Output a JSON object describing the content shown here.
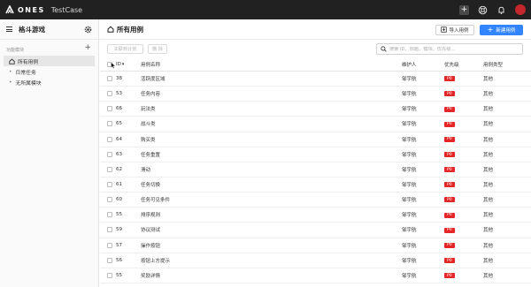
{
  "topbar": {
    "brand": "ONES",
    "app_name": "TestCase",
    "plus_label": "+"
  },
  "sidebar": {
    "project_name": "格斗游戏",
    "section_label": "功能模块",
    "add_label": "+",
    "items": [
      {
        "label": "所有用例",
        "active": true
      },
      {
        "label": "日常任务",
        "active": false
      },
      {
        "label": "无所属模块",
        "active": false
      }
    ]
  },
  "main": {
    "title": "所有用例",
    "import_label": "导入用例",
    "new_label": "新建用例",
    "toolbar": {
      "plan_label": "关联到计划",
      "delete_label": "删 除",
      "search_placeholder": "搜索 ID、标题、模块、优先级..."
    },
    "table": {
      "headers": {
        "id": "ID",
        "name": "用例名称",
        "owner": "维护人",
        "priority": "优先级",
        "type": "用例类型"
      },
      "rows": [
        {
          "id": "38",
          "name": "活跃度区域",
          "owner": "邹宇航",
          "priority": "P0",
          "type": "其他"
        },
        {
          "id": "53",
          "name": "任务内容",
          "owner": "邹宇航",
          "priority": "P0",
          "type": "其他"
        },
        {
          "id": "66",
          "name": "玩法类",
          "owner": "邹宇航",
          "priority": "P0",
          "type": "其他"
        },
        {
          "id": "65",
          "name": "战斗类",
          "owner": "邹宇航",
          "priority": "P0",
          "type": "其他"
        },
        {
          "id": "64",
          "name": "购买类",
          "owner": "邹宇航",
          "priority": "P0",
          "type": "其他"
        },
        {
          "id": "63",
          "name": "任务重置",
          "owner": "邹宇航",
          "priority": "P0",
          "type": "其他"
        },
        {
          "id": "62",
          "name": "滑动",
          "owner": "邹宇航",
          "priority": "P0",
          "type": "其他"
        },
        {
          "id": "61",
          "name": "任务切换",
          "owner": "邹宇航",
          "priority": "P0",
          "type": "其他"
        },
        {
          "id": "60",
          "name": "任务可见条件",
          "owner": "邹宇航",
          "priority": "P0",
          "type": "其他"
        },
        {
          "id": "55",
          "name": "排序规则",
          "owner": "邹宇航",
          "priority": "P0",
          "type": "其他"
        },
        {
          "id": "59",
          "name": "协议测试",
          "owner": "邹宇航",
          "priority": "P0",
          "type": "其他"
        },
        {
          "id": "57",
          "name": "操作按钮",
          "owner": "邹宇航",
          "priority": "P0",
          "type": "其他"
        },
        {
          "id": "56",
          "name": "按钮上方提示",
          "owner": "邹宇航",
          "priority": "P0",
          "type": "其他"
        },
        {
          "id": "55",
          "name": "奖励详情",
          "owner": "邹宇航",
          "priority": "P0",
          "type": "其他"
        },
        {
          "id": "54",
          "name": "奖励",
          "owner": "邹宇航",
          "priority": "P0",
          "type": "其他"
        }
      ]
    }
  },
  "colors": {
    "topbar_bg": "#212121",
    "accent_blue": "#3385ff",
    "priority_red": "#e52626",
    "avatar_red": "#c3262d"
  }
}
